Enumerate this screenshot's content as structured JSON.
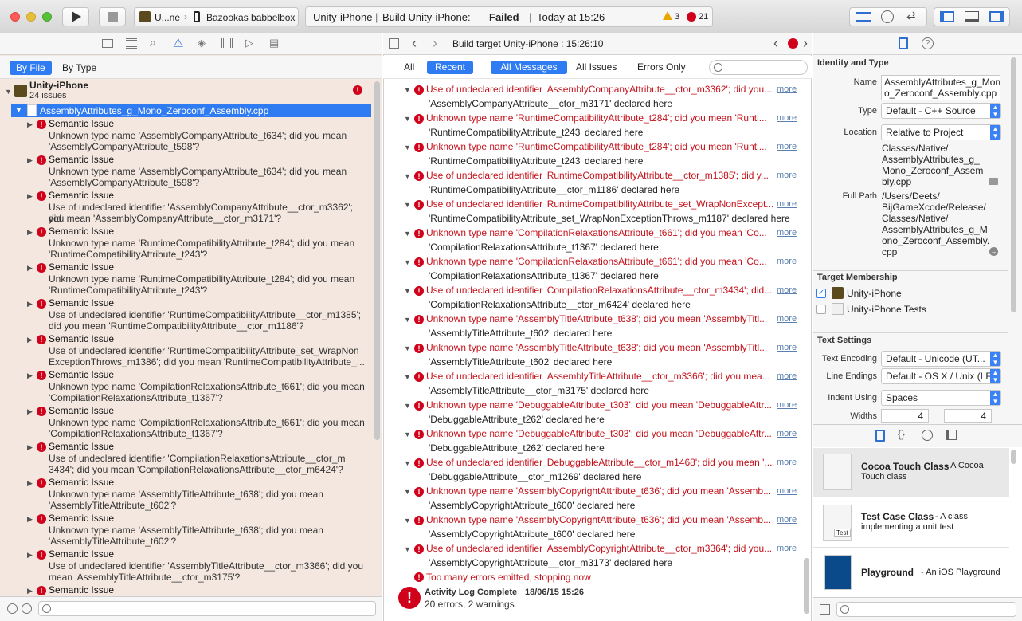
{
  "window": {
    "traffic_lights": [
      "#fc5b57",
      "#e5bf3c",
      "#57c038"
    ]
  },
  "toolbar": {
    "scheme_target": "U...ne",
    "scheme_device": "Bazookas babbelbox",
    "activity_project": "Unity-iPhone",
    "activity_sep1": "|",
    "activity_status_prefix": "Build Unity-iPhone:",
    "activity_status": "Failed",
    "activity_sep2": "|",
    "activity_time": "Today at 15:26",
    "warning_count": "3",
    "error_count": "21"
  },
  "navigator": {
    "filter_by_file": "By File",
    "filter_by_type": "By Type",
    "project_name": "Unity-iPhone",
    "project_issues": "24 issues",
    "file_name": "AssemblyAttributes_g_Mono_Zeroconf_Assembly.cpp",
    "issues": [
      {
        "title": "Semantic Issue",
        "line1": "Unknown type name 'AssemblyCompanyAttribute_t634'; did you mean",
        "line2": "'AssemblyCompanyAttribute_t598'?"
      },
      {
        "title": "Semantic Issue",
        "line1": "Unknown type name 'AssemblyCompanyAttribute_t634'; did you mean",
        "line2": "'AssemblyCompanyAttribute_t598'?"
      },
      {
        "title": "Semantic Issue",
        "line1": "Use of undeclared identifier 'AssemblyCompanyAttribute__ctor_m3362'; did",
        "line2": "you mean 'AssemblyCompanyAttribute__ctor_m3171'?"
      },
      {
        "title": "Semantic Issue",
        "line1": "Unknown type name 'RuntimeCompatibilityAttribute_t284'; did you mean",
        "line2": "'RuntimeCompatibilityAttribute_t243'?"
      },
      {
        "title": "Semantic Issue",
        "line1": "Unknown type name 'RuntimeCompatibilityAttribute_t284'; did you mean",
        "line2": "'RuntimeCompatibilityAttribute_t243'?"
      },
      {
        "title": "Semantic Issue",
        "line1": "Use of undeclared identifier 'RuntimeCompatibilityAttribute__ctor_m1385';",
        "line2": "did you mean 'RuntimeCompatibilityAttribute__ctor_m1186'?"
      },
      {
        "title": "Semantic Issue",
        "line1": "Use of undeclared identifier 'RuntimeCompatibilityAttribute_set_WrapNon",
        "line2": "ExceptionThrows_m1386'; did you mean 'RuntimeCompatibilityAttribute_..."
      },
      {
        "title": "Semantic Issue",
        "line1": "Unknown type name 'CompilationRelaxationsAttribute_t661'; did you mean",
        "line2": "'CompilationRelaxationsAttribute_t1367'?"
      },
      {
        "title": "Semantic Issue",
        "line1": "Unknown type name 'CompilationRelaxationsAttribute_t661'; did you mean",
        "line2": "'CompilationRelaxationsAttribute_t1367'?"
      },
      {
        "title": "Semantic Issue",
        "line1": "Use of undeclared identifier 'CompilationRelaxationsAttribute__ctor_m",
        "line2": "3434'; did you mean 'CompilationRelaxationsAttribute__ctor_m6424'?"
      },
      {
        "title": "Semantic Issue",
        "line1": "Unknown type name 'AssemblyTitleAttribute_t638'; did you mean",
        "line2": "'AssemblyTitleAttribute_t602'?"
      },
      {
        "title": "Semantic Issue",
        "line1": "Unknown type name 'AssemblyTitleAttribute_t638'; did you mean",
        "line2": "'AssemblyTitleAttribute_t602'?"
      },
      {
        "title": "Semantic Issue",
        "line1": "Use of undeclared identifier 'AssemblyTitleAttribute__ctor_m3366'; did you",
        "line2": "mean 'AssemblyTitleAttribute__ctor_m3175'?"
      },
      {
        "title": "Semantic Issue",
        "line1": "",
        "line2": ""
      }
    ]
  },
  "editor": {
    "jump_title": "Build target Unity-iPhone : 15:26:10",
    "filters": {
      "all": "All",
      "recent": "Recent",
      "all_messages": "All Messages",
      "all_issues": "All Issues",
      "errors_only": "Errors Only"
    },
    "more_label": "more",
    "messages": [
      {
        "msg": "Use of undeclared identifier 'AssemblyCompanyAttribute__ctor_m3362'; did you...",
        "decl": "'AssemblyCompanyAttribute__ctor_m3171' declared here"
      },
      {
        "msg": "Unknown type name 'RuntimeCompatibilityAttribute_t284'; did you mean 'Runti...",
        "decl": "'RuntimeCompatibilityAttribute_t243' declared here"
      },
      {
        "msg": "Unknown type name 'RuntimeCompatibilityAttribute_t284'; did you mean 'Runti...",
        "decl": "'RuntimeCompatibilityAttribute_t243' declared here"
      },
      {
        "msg": "Use of undeclared identifier 'RuntimeCompatibilityAttribute__ctor_m1385'; did y...",
        "decl": "'RuntimeCompatibilityAttribute__ctor_m1186' declared here"
      },
      {
        "msg": "Use of undeclared identifier 'RuntimeCompatibilityAttribute_set_WrapNonExcept...",
        "decl": "'RuntimeCompatibilityAttribute_set_WrapNonExceptionThrows_m1187' declared here"
      },
      {
        "msg": "Unknown type name 'CompilationRelaxationsAttribute_t661'; did you mean 'Co...",
        "decl": "'CompilationRelaxationsAttribute_t1367' declared here"
      },
      {
        "msg": "Unknown type name 'CompilationRelaxationsAttribute_t661'; did you mean 'Co...",
        "decl": "'CompilationRelaxationsAttribute_t1367' declared here"
      },
      {
        "msg": "Use of undeclared identifier 'CompilationRelaxationsAttribute__ctor_m3434'; did...",
        "decl": "'CompilationRelaxationsAttribute__ctor_m6424' declared here"
      },
      {
        "msg": "Unknown type name 'AssemblyTitleAttribute_t638'; did you mean 'AssemblyTitl...",
        "decl": "'AssemblyTitleAttribute_t602' declared here"
      },
      {
        "msg": "Unknown type name 'AssemblyTitleAttribute_t638'; did you mean 'AssemblyTitl...",
        "decl": "'AssemblyTitleAttribute_t602' declared here"
      },
      {
        "msg": "Use of undeclared identifier 'AssemblyTitleAttribute__ctor_m3366'; did you mea...",
        "decl": "'AssemblyTitleAttribute__ctor_m3175' declared here"
      },
      {
        "msg": "Unknown type name 'DebuggableAttribute_t303'; did you mean 'DebuggableAttr...",
        "decl": "'DebuggableAttribute_t262' declared here"
      },
      {
        "msg": "Unknown type name 'DebuggableAttribute_t303'; did you mean 'DebuggableAttr...",
        "decl": "'DebuggableAttribute_t262' declared here"
      },
      {
        "msg": "Use of undeclared identifier 'DebuggableAttribute__ctor_m1468'; did you mean '...",
        "decl": "'DebuggableAttribute__ctor_m1269' declared here"
      },
      {
        "msg": "Unknown type name 'AssemblyCopyrightAttribute_t636'; did you mean 'Assemb...",
        "decl": "'AssemblyCopyrightAttribute_t600' declared here"
      },
      {
        "msg": "Unknown type name 'AssemblyCopyrightAttribute_t636'; did you mean 'Assemb...",
        "decl": "'AssemblyCopyrightAttribute_t600' declared here"
      },
      {
        "msg": "Use of undeclared identifier 'AssemblyCopyrightAttribute__ctor_m3364'; did you...",
        "decl": "'AssemblyCopyrightAttribute__ctor_m3173' declared here"
      }
    ],
    "too_many": "Too many errors emitted, stopping now",
    "log_title": "Activity Log Complete",
    "log_time": "18/06/15 15:26",
    "log_summary": "20 errors, 2 warnings"
  },
  "inspector": {
    "identity_heading": "Identity and Type",
    "name_label": "Name",
    "name_value_1": "AssemblyAttributes_g_Mon",
    "name_value_2": "o_Zeroconf_Assembly.cpp",
    "type_label": "Type",
    "type_value": "Default - C++ Source",
    "location_label": "Location",
    "location_value": "Relative to Project",
    "location_path": [
      "Classes/Native/",
      "AssemblyAttributes_g_",
      "Mono_Zeroconf_Assem",
      "bly.cpp"
    ],
    "fullpath_label": "Full Path",
    "fullpath_value": [
      "/Users/Deets/",
      "BijGameXcode/Release/",
      "Classes/Native/",
      "AssemblyAttributes_g_M",
      "ono_Zeroconf_Assembly.",
      "cpp"
    ],
    "target_heading": "Target Membership",
    "targets": [
      {
        "name": "Unity-iPhone",
        "checked": true
      },
      {
        "name": "Unity-iPhone Tests",
        "checked": false
      }
    ],
    "text_heading": "Text Settings",
    "encoding_label": "Text Encoding",
    "encoding_value": "Default - Unicode (UT...",
    "endings_label": "Line Endings",
    "endings_value": "Default - OS X / Unix (LF)",
    "indent_label": "Indent Using",
    "indent_value": "Spaces",
    "widths_label": "Widths",
    "width_tab": "4",
    "width_indent": "4"
  },
  "library": {
    "items": [
      {
        "title": "Cocoa Touch Class",
        "desc1": " - A Cocoa",
        "desc2": "Touch class"
      },
      {
        "title": "Test Case Class",
        "desc1": " - A class",
        "desc2": "implementing a unit test"
      },
      {
        "title": "Playground",
        "desc1": " - An iOS Playground",
        "desc2": ""
      }
    ],
    "test_badge": "Test"
  }
}
